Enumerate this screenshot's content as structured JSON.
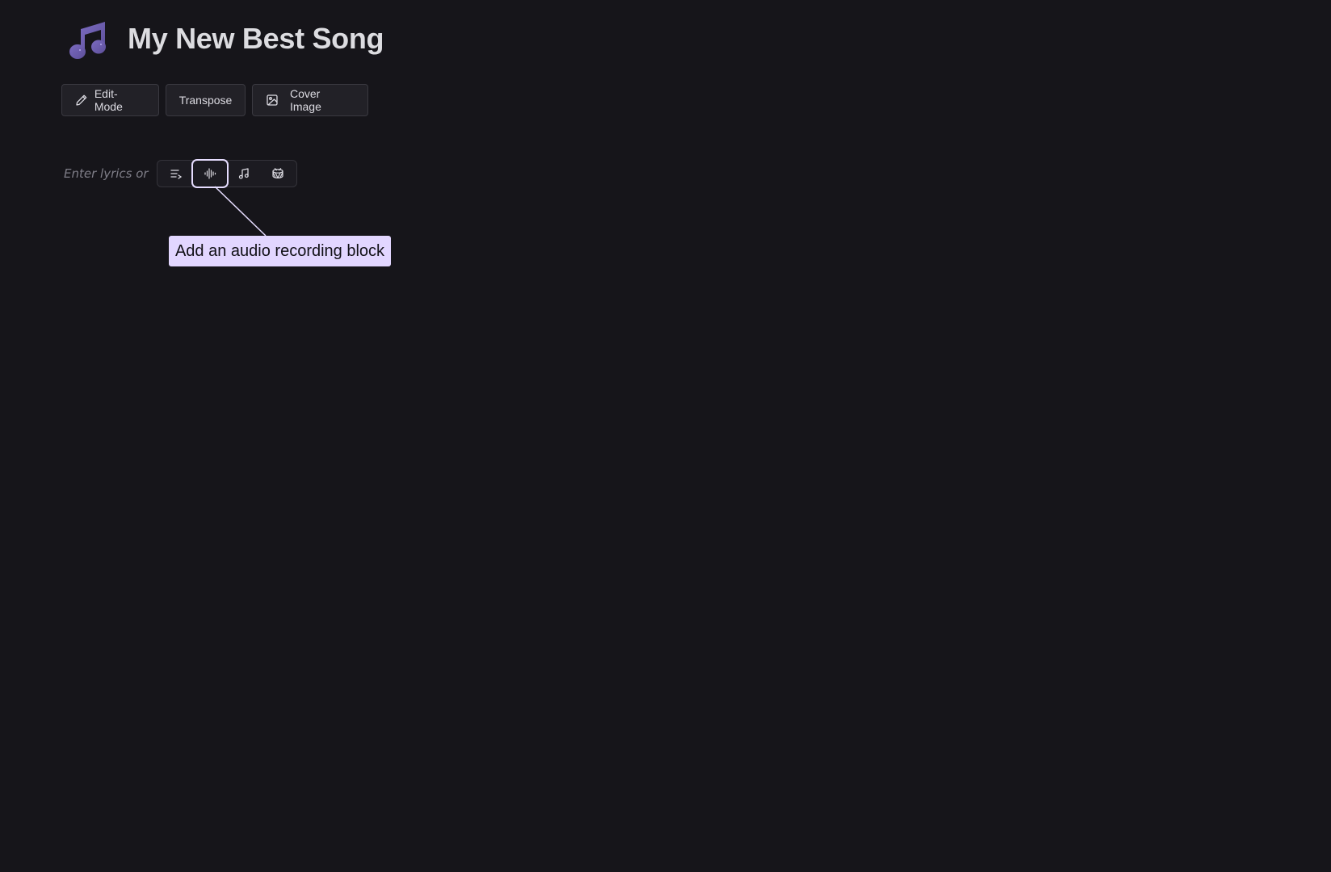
{
  "header": {
    "title": "My New Best Song",
    "logo_icon": "music-note-icon",
    "logo_color": "#6e5fae"
  },
  "toolbar": {
    "edit_mode_label": "Edit-Mode",
    "edit_mode_icon": "pencil-icon",
    "transpose_label": "Transpose",
    "cover_image_label": "Cover Image",
    "cover_image_icon": "image-icon"
  },
  "editor": {
    "placeholder": "Enter lyrics or",
    "block_buttons": [
      {
        "icon": "text-lines-icon",
        "focused": false
      },
      {
        "icon": "audio-waveform-icon",
        "focused": true
      },
      {
        "icon": "music-note-icon",
        "focused": false
      },
      {
        "icon": "drum-icon",
        "focused": false
      }
    ]
  },
  "tooltip": {
    "text": "Add an audio recording block",
    "background": "#e2d6ff"
  },
  "colors": {
    "background": "#16151a",
    "button_bg": "#222127",
    "button_border": "#3a3940",
    "focus_ring": "#e6ddff"
  }
}
